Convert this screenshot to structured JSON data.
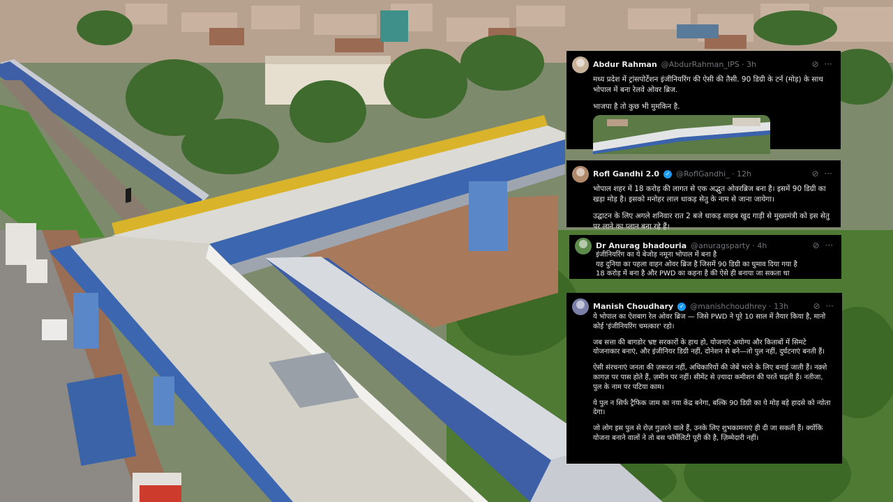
{
  "tweets": [
    {
      "name": "Abdur Rahman",
      "handle": "@AbdurRahman_IPS · 3h",
      "verified": false,
      "avatar_color": "#c7b299",
      "paragraphs": [
        "मध्य प्रदेश में ट्रांसपोर्टेशन इंजीनियरिंग की ऐसी की तैसी. 90 डिग्री के टर्न (मोड़) के साथ भोपाल में बना रेलवे ओवर ब्रिज.",
        "भाजपा है तो कुछ भी मुमकिन है."
      ],
      "has_media": true
    },
    {
      "name": "Rofl Gandhi 2.0",
      "handle": "@RoflGandhi_ · 12h",
      "verified": true,
      "avatar_color": "#b08a6a",
      "paragraphs": [
        "भोपाल शहर में 18 करोड़ की लागत से एक अद्भुत ओवरब्रिज बना है। इसमें 90 डिग्री का खड़ा मोड़ है। इसको मनोहर लाल धाकड़ सेतु के नाम से जाना जायेगा।",
        "उद्घाटन के लिए अगले शनिवार रात 2 बजे धाकड़ साहब खुद गाड़ी से मुख्यमंत्री को इस सेतु पर लाने का प्लान बना रहे हैं।"
      ],
      "has_media": false
    },
    {
      "name": "Dr Anurag bhadouria",
      "handle": "@anuragsparty · 4h",
      "verified": false,
      "avatar_color": "#5c8a4a",
      "paragraphs": [
        "इंजीनियरिंग का ये बेजोड़ नमूना भोपाल में बना है\nयह दुनिया का पहला वाहन ओवर ब्रिज है जिसमें 90 डिग्री का घुमाव दिया गया है\n18 करोड़ में बना है और PWD का कहना है की ऐसे ही बनाया जा सकता था"
      ],
      "has_media": false
    },
    {
      "name": "Manish Choudhary",
      "handle": "@manishchoudhrey · 13h",
      "verified": true,
      "avatar_color": "#7a7fa8",
      "paragraphs": [
        "ये भोपाल का ऐशबाग रेल ओवर ब्रिज — जिसे PWD ने पूरे 10 साल में तैयार किया है, मानो कोई 'इंजीनियरिंग चमत्कार' रहो।",
        "जब सत्ता की बागडोर भ्रष्ट सरकारों के हाथ हो, योजनाएं अयोग्य और किताबों में सिमटे योजनाकार बनाएं, और इंजीनियर डिग्री नहीं, दोनेशन से बने—तो पुल नहीं, दुर्घटनाएं बनती हैं।",
        "ऐसी संरचनाएं जनता की ज़रूरत नहीं, अधिकारियों की जेबें भरने के लिए बनाई जाती हैं। नक़्शे कागज़ पर पास होते हैं, ज़मीन पर नहीं। सीमेंट से ज़्यादा कमीशन की परतें चढ़ती हैं। नतीजा, पुल के नाम पर पटिया काम।",
        "ये पुल न सिर्फ ट्रैफिक जाम का नया केंद्र बनेगा, बल्कि 90 डिग्री का ये मोड़ बड़े हादसे को न्योता देगा।",
        "जो लोग इस पुल से रोज़ गुज़रने वाले हैं, उनके लिए शुभकामनाएं ही दी जा सकती हैं। क्योंकि योजना बनाने वालों ने तो बस फॉर्मेलिटी पूरी की है, ज़िम्मेदारी नहीं।"
      ],
      "has_media": false
    }
  ],
  "icons": {
    "grok": "grok-icon",
    "more": "more-icon",
    "verified": "verified-badge-icon"
  }
}
